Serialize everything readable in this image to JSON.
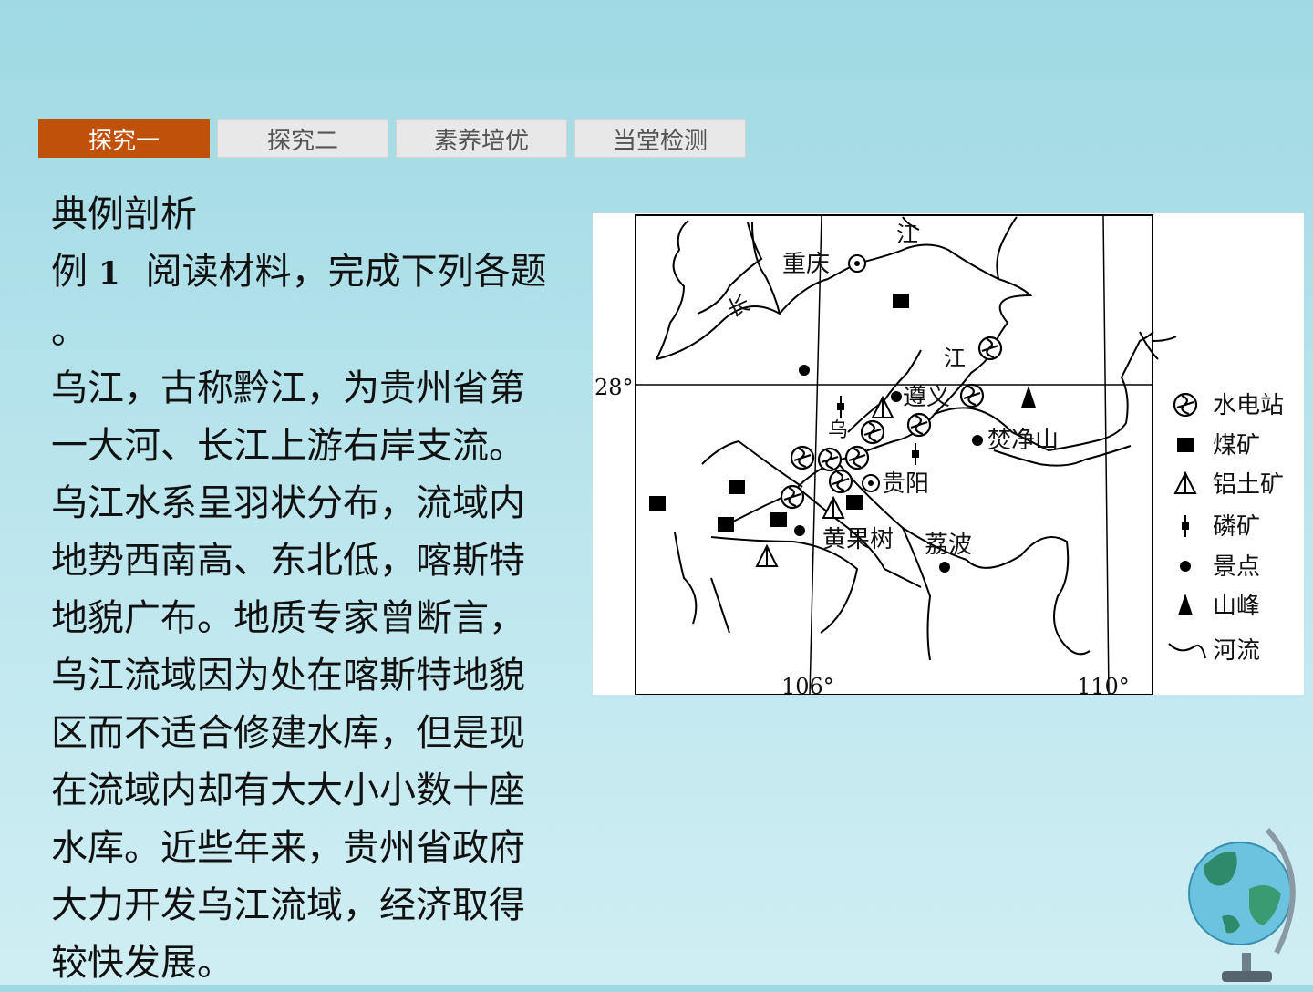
{
  "tabs": [
    {
      "label": "探究一",
      "active": true
    },
    {
      "label": "探究二",
      "active": false
    },
    {
      "label": "素养培优",
      "active": false
    },
    {
      "label": "当堂检测",
      "active": false
    }
  ],
  "content": {
    "heading": "典例剖析",
    "example_prefix": "例",
    "example_number": "1",
    "example_title": "阅读材料，完成下列各题",
    "title_tail": "。",
    "paragraph_lines": [
      "乌江，古称黔江，为贵州省第",
      "一大河、长江上游右岸支流。",
      "乌江水系呈羽状分布，流域内",
      "地势西南高、东北低，喀斯特",
      "地貌广布。地质专家曾断言，",
      "乌江流域因为处在喀斯特地貌",
      "区而不适合修建水库，但是现",
      "在流域内却有大大小小数十座",
      "水库。近些年来，贵州省政府",
      "大力开发乌江流域，经济取得",
      "较快发展。"
    ]
  },
  "map": {
    "lat_label": "28°",
    "lon_labels": [
      "106°",
      "110°"
    ],
    "places": {
      "chongqing": "重庆",
      "zunyi": "遵义",
      "guiyang": "贵阳",
      "huangguoshu": "黄果树",
      "libo": "荔波",
      "fanjingshan": "焚净山"
    },
    "river_chars": {
      "chang": "长",
      "jiang_top": "江",
      "jiang_mid": "江",
      "wu": "乌"
    },
    "legend": [
      {
        "label": "水电站",
        "icon": "hydropower-icon"
      },
      {
        "label": "煤矿",
        "icon": "coal-mine-icon"
      },
      {
        "label": "铝土矿",
        "icon": "bauxite-icon"
      },
      {
        "label": "磷矿",
        "icon": "phosphate-icon"
      },
      {
        "label": "景点",
        "icon": "scenic-spot-icon"
      },
      {
        "label": "山峰",
        "icon": "mountain-peak-icon"
      },
      {
        "label": "河流",
        "icon": "river-icon"
      }
    ]
  },
  "colors": {
    "active_tab": "#c0510b",
    "tab_bg": "#e8e8e8",
    "background": "#a8dde6"
  }
}
